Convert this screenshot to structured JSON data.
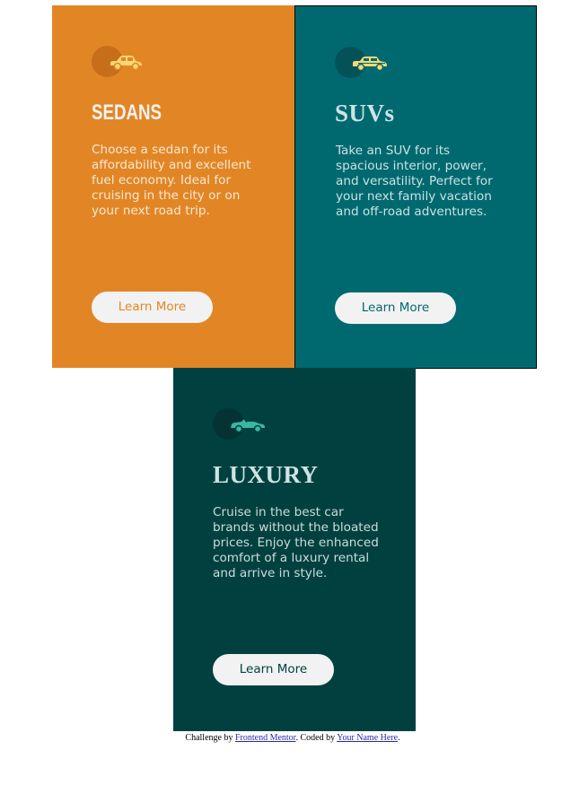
{
  "cards": [
    {
      "title": "SEDANS",
      "text": "Choose a sedan for its affordability and excellent fuel economy. Ideal for cruising in the city or on your next road trip.",
      "button_label": "Learn More",
      "icon": "sedan-car-icon",
      "colors": {
        "background": "#e28625",
        "title": "#f2f2f2",
        "button_text": "#e28625",
        "icon_circle": "#c76e1a",
        "icon": "#fbd873"
      }
    },
    {
      "title": "SUVs",
      "text": "Take an SUV for its spacious interior, power, and versatility. Perfect for your next family vacation and off-road adventures.",
      "button_label": "Learn More",
      "icon": "suv-car-icon",
      "colors": {
        "background": "#006970",
        "title": "#cfe3e3",
        "button_text": "#006970",
        "icon_circle": "#035258",
        "icon": "#fbd873"
      }
    },
    {
      "title": "LUXURY",
      "text": "Cruise in the best car brands without the bloated prices. Enjoy the enhanced comfort of a luxury rental and arrive in style.",
      "button_label": "Learn More",
      "icon": "luxury-car-icon",
      "colors": {
        "background": "#004140",
        "title": "#cfe3e3",
        "button_text": "#004140",
        "icon_circle": "#053333",
        "icon": "#3ab7a0"
      }
    }
  ],
  "attribution": {
    "prefix": "Challenge by ",
    "link1": "Frontend Mentor",
    "middle": ". Coded by ",
    "link2": "Your Name Here",
    "suffix": "."
  }
}
